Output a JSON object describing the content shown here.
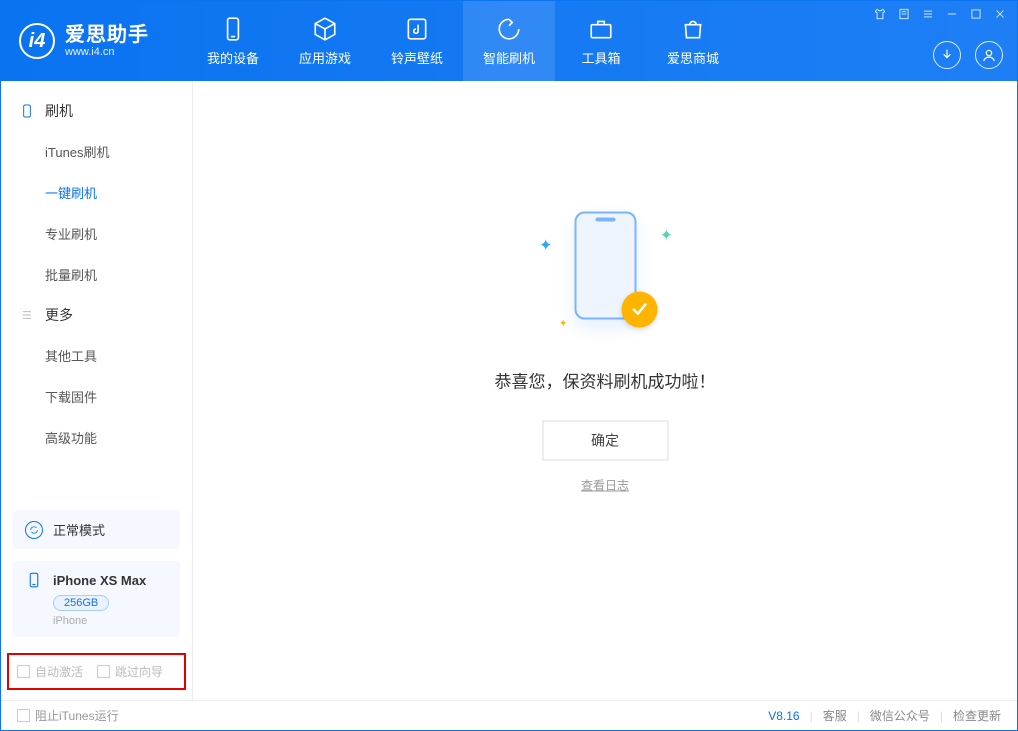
{
  "logo": {
    "title": "爱思助手",
    "subtitle": "www.i4.cn"
  },
  "tabs": {
    "device": "我的设备",
    "apps": "应用游戏",
    "ring": "铃声壁纸",
    "flash": "智能刷机",
    "tool": "工具箱",
    "store": "爱思商城"
  },
  "sidebar": {
    "group_flash": "刷机",
    "itunes_flash": "iTunes刷机",
    "one_click": "一键刷机",
    "pro_flash": "专业刷机",
    "batch_flash": "批量刷机",
    "group_more": "更多",
    "other_tools": "其他工具",
    "download_fw": "下载固件",
    "advanced": "高级功能",
    "mode_label": "正常模式",
    "device_name": "iPhone XS Max",
    "capacity": "256GB",
    "device_type": "iPhone",
    "auto_activate": "自动激活",
    "skip_guide": "跳过向导"
  },
  "main": {
    "message": "恭喜您，保资料刷机成功啦！",
    "ok": "确定",
    "view_log": "查看日志"
  },
  "footer": {
    "block_itunes": "阻止iTunes运行",
    "version": "V8.16",
    "support": "客服",
    "wechat": "微信公众号",
    "update": "检查更新"
  }
}
